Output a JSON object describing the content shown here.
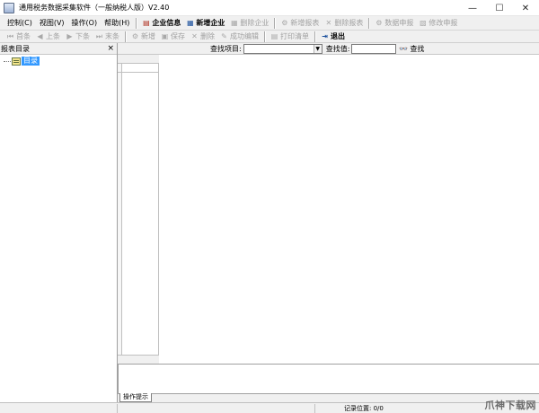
{
  "window": {
    "title": "通用税务数据采集软件（一般纳税人版）V2.40",
    "controls": {
      "minimize": "—",
      "maximize": "☐",
      "close": "✕"
    }
  },
  "menu": [
    {
      "label": "控制(C)",
      "underline": "C"
    },
    {
      "label": "视图(V)",
      "underline": "V"
    },
    {
      "label": "操作(O)",
      "underline": "O"
    },
    {
      "label": "帮助(H)",
      "underline": "H"
    }
  ],
  "toolbar_main": [
    {
      "label": "企业信息",
      "icon": "building-icon",
      "enabled": true
    },
    {
      "label": "新增企业",
      "icon": "add-company-icon",
      "enabled": true
    },
    {
      "label": "删除企业",
      "icon": "delete-company-icon",
      "enabled": false
    },
    {
      "label": "新增报表",
      "icon": "add-report-icon",
      "enabled": false
    },
    {
      "label": "删除报表",
      "icon": "delete-report-icon",
      "enabled": false
    },
    {
      "label": "数据申报",
      "icon": "declare-icon",
      "enabled": false
    },
    {
      "label": "修改申报",
      "icon": "edit-declare-icon",
      "enabled": false
    }
  ],
  "toolbar_nav": [
    {
      "label": "首条",
      "icon": "first-icon",
      "enabled": false
    },
    {
      "label": "上条",
      "icon": "prev-icon",
      "enabled": false
    },
    {
      "label": "下条",
      "icon": "next-icon",
      "enabled": false
    },
    {
      "label": "末条",
      "icon": "last-icon",
      "enabled": false
    }
  ],
  "toolbar_edit": [
    {
      "label": "新增",
      "icon": "new-icon",
      "enabled": false
    },
    {
      "label": "保存",
      "icon": "save-icon",
      "enabled": false
    },
    {
      "label": "删除",
      "icon": "delete-icon",
      "enabled": false
    },
    {
      "label": "成功编辑",
      "icon": "edit-icon",
      "enabled": false
    },
    {
      "label": "打印清单",
      "icon": "print-icon",
      "enabled": false
    },
    {
      "label": "退出",
      "icon": "exit-icon",
      "enabled": true
    }
  ],
  "left_panel": {
    "title": "报表目录",
    "close": "×",
    "tree": [
      {
        "label": "目录",
        "selected": true
      }
    ]
  },
  "search": {
    "item_label": "查找项目:",
    "item_value": "",
    "value_label": "查找值:",
    "value": "",
    "button": "查找"
  },
  "hint": {
    "tab_label": "操作提示"
  },
  "status": {
    "record_position": "记录位置: 0/0"
  },
  "watermark": "爪神下载网"
}
